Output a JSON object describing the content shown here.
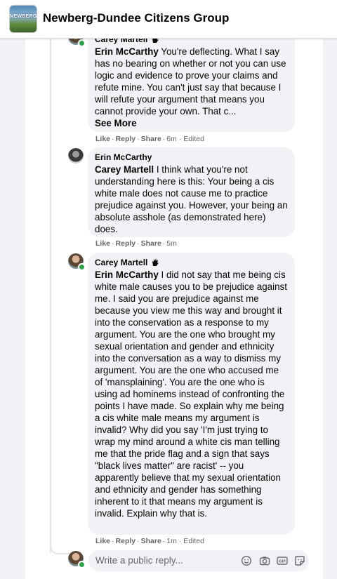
{
  "header": {
    "group_name": "Newberg-Dundee Citizens Group",
    "logo_text": "NEWBERG"
  },
  "comments": [
    {
      "author": "Carey Martell",
      "mention": "Erin McCarthy",
      "text": " You're deflecting. What I say has no bearing on whether or not you can use logic and evidence to prove your claims and refute mine. You can't just say that because I will refute your argument that means you cannot provide your own. That c...",
      "see_more": "See More",
      "like": "Like",
      "reply": "Reply",
      "share": "Share",
      "meta": "6m · Edited"
    },
    {
      "author": "Erin McCarthy",
      "mention": "Carey Martell",
      "text": " I think what you're not understanding here is this: Your being a cis white male does not cause me to practice prejudice against you. However, your being an absolute asshole (as demonstrated here) does.",
      "like": "Like",
      "reply": "Reply",
      "share": "Share",
      "meta": "5m"
    },
    {
      "author": "Carey Martell",
      "mention": "Erin McCarthy",
      "text": " I did not say that me being cis white male causes you to be prejudice against me. I said you are prejudice against me because you view me this way and brought it into the conservation as a response to my argument. You are the one who brought my sexual orientation and gender and ethnicity into the conversation as a way to dismiss my argument. You are the one who accused me of 'mansplaining'. You are the one who is using ad hominems instead of confronting the points I have made. So explain why me being a cis white male means my argument is invalid? Why did you say 'I'm just trying to wrap my mind around a white cis man telling me that the pride flag and a sign that says \"black lives matter\" are racist' -- you apparently believe that my sexual orientation and ethnicity and gender has something inherent to it that means my argument is invalid. Explain why that is.",
      "like": "Like",
      "reply": "Reply",
      "share": "Share",
      "meta": "1m · Edited"
    }
  ],
  "reply_box": {
    "placeholder": "Write a public reply...",
    "icons": [
      "emoji-icon",
      "camera-icon",
      "gif-icon",
      "sticker-icon"
    ]
  },
  "colors": {
    "bubble": "#f0f2f5",
    "meta_text": "#65676b",
    "online": "#31a24c"
  }
}
